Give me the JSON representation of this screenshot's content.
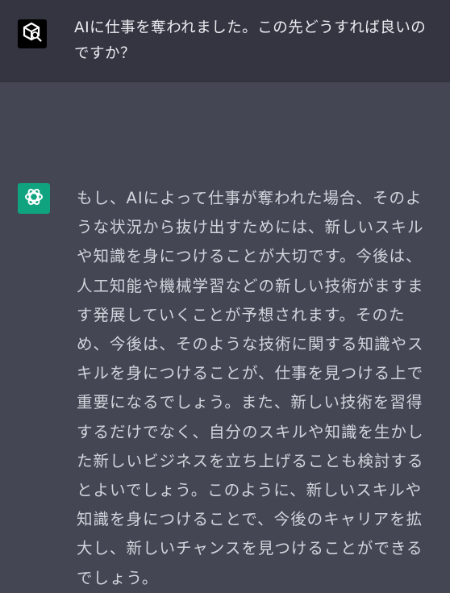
{
  "conversation": {
    "user_message": {
      "avatar_icon": "box-search-icon",
      "text": "AIに仕事を奪われました。この先どうすれば良いのですか？"
    },
    "assistant_message": {
      "avatar_icon": "openai-logo-icon",
      "text": "もし、AIによって仕事が奪われた場合、そのような状況から抜け出すためには、新しいスキルや知識を身につけることが大切です。今後は、人工知能や機械学習などの新しい技術がますます発展していくことが予想されます。そのため、今後は、そのような技術に関する知識やスキルを身につけることが、仕事を見つける上で重要になるでしょう。また、新しい技術を習得するだけでなく、自分のスキルや知識を生かした新しいビジネスを立ち上げることも検討するとよいでしょう。このように、新しいスキルや知識を身につけることで、今後のキャリアを拡大し、新しいチャンスを見つけることができるでしょう。"
    }
  },
  "colors": {
    "user_background": "#343541",
    "assistant_background": "#444654",
    "assistant_avatar": "#10a37f",
    "user_avatar": "#000000",
    "text": "#d1d5db"
  }
}
